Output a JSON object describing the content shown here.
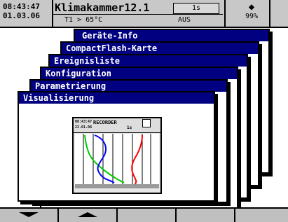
{
  "header": {
    "time": "08:43:47",
    "date": "01.03.06",
    "title": "Klimakammer12.1",
    "interval": "1s",
    "condition": "T1 > 65°C",
    "state": "AUS",
    "battery": "99%"
  },
  "menu": {
    "items": [
      {
        "label": "Geräte-Info"
      },
      {
        "label": "CompactFlash-Karte"
      },
      {
        "label": "Ereignisliste"
      },
      {
        "label": "Konfiguration"
      },
      {
        "label": "Parametrierung"
      },
      {
        "label": "Visualisierung"
      }
    ]
  },
  "recorder": {
    "time": "08:43:47",
    "date": "22.01.06",
    "title": "RECORDER",
    "interval": "1s"
  },
  "colors": {
    "menu_bar": "#000080",
    "green_trace": "#00cc00",
    "blue_trace": "#0000ff",
    "red_trace": "#ff0000"
  }
}
